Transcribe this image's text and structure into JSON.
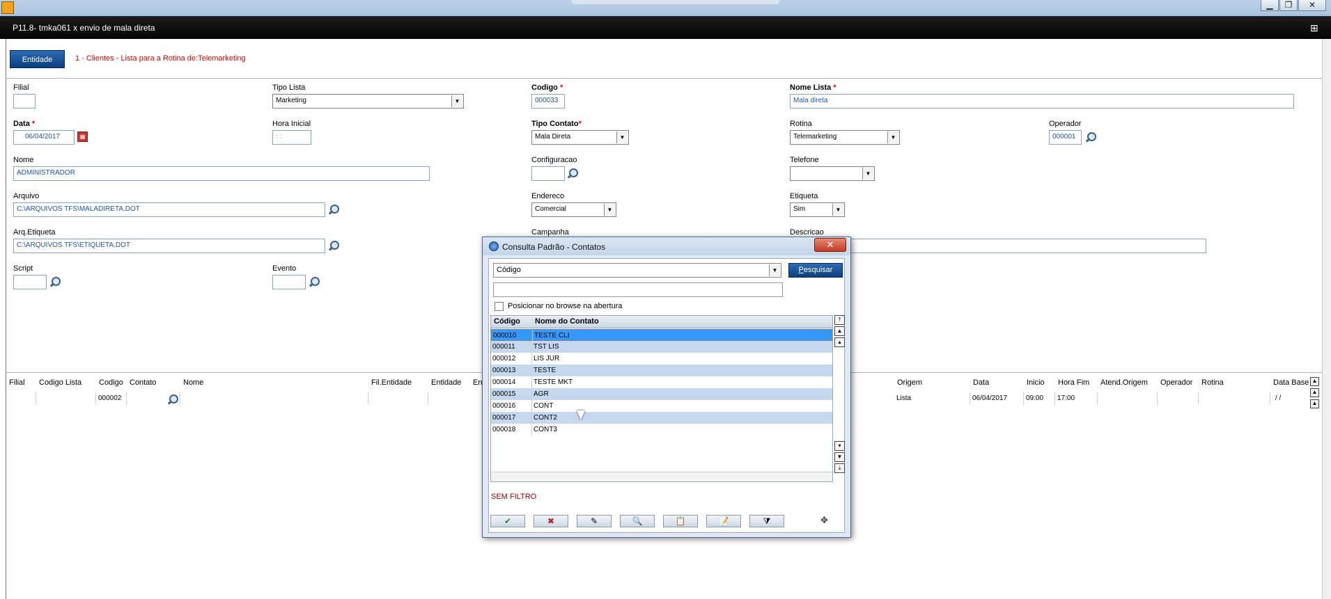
{
  "window": {
    "title": "P11.8- tmka061 x envio de mala direta",
    "minimize": "▁",
    "maximize": "❐",
    "close": "✕",
    "grid_icon": "⊞"
  },
  "entity": {
    "button": "Entidade",
    "description": "1 - Clientes - Lista para a Rotina de:Telemarketing"
  },
  "form": {
    "filial": {
      "label": "Filial",
      "value": ""
    },
    "tipo_lista": {
      "label": "Tipo Lista",
      "value": "Marketing"
    },
    "codigo": {
      "label": "Codigo",
      "value": "000033",
      "required": "*"
    },
    "nome_lista": {
      "label": "Nome Lista",
      "value": "Mala direta",
      "required": "*"
    },
    "data": {
      "label": "Data",
      "value": "06/04/2017",
      "required": "*"
    },
    "hora_inicial": {
      "label": "Hora Inicial",
      "value": " :  :"
    },
    "tipo_contato": {
      "label": "Tipo Contato",
      "value": "Mala Direta",
      "required": "*"
    },
    "rotina": {
      "label": "Rotina",
      "value": "Telemarketing"
    },
    "operador": {
      "label": "Operador",
      "value": "000001"
    },
    "nome": {
      "label": "Nome",
      "value": "ADMINISTRADOR"
    },
    "configuracao": {
      "label": "Configuracao",
      "value": ""
    },
    "telefone": {
      "label": "Telefone",
      "value": ""
    },
    "arquivo": {
      "label": "Arquivo",
      "value": "C:\\ARQUIVOS TFS\\MALADIRETA.DOT"
    },
    "endereco": {
      "label": "Endereco",
      "value": "Comercial"
    },
    "etiqueta": {
      "label": "Etiqueta",
      "value": "Sim"
    },
    "arq_etiqueta": {
      "label": "Arq.Etiqueta",
      "value": "C:\\ARQUIVOS TFS\\ETIQUETA.DOT"
    },
    "campanha": {
      "label": "Campanha",
      "value": ""
    },
    "descricao": {
      "label": "Descricao",
      "value": ""
    },
    "script": {
      "label": "Script",
      "value": ""
    },
    "evento": {
      "label": "Evento",
      "value": ""
    }
  },
  "grid": {
    "headers": [
      "Filial",
      "Codigo Lista",
      "Codigo",
      "Contato",
      "Nome",
      "Fil.Entidade",
      "Entidade",
      "Ent",
      "Origem",
      "Data",
      "Inicio",
      "Hora Fim",
      "Atend.Origem",
      "Operador",
      "Rotina",
      "Data Base"
    ],
    "row": {
      "codigo": "000002",
      "origem": "Lista",
      "data": "06/04/2017",
      "inicio": "09:00",
      "hora_fim": "17:00",
      "data_base": " / /"
    }
  },
  "dialog": {
    "title": "Consulta Padrão - Contatos",
    "close": "✕",
    "search_field": "Código",
    "search_button_accel": "P",
    "search_button_rest": "esquisar",
    "search_value": "",
    "checkbox_label": "Posicionar no browse na abertura",
    "columns": [
      "Código",
      "Nome do Contato"
    ],
    "rows": [
      {
        "codigo": "000010",
        "nome": "TESTE CLI"
      },
      {
        "codigo": "000011",
        "nome": "TST LIS"
      },
      {
        "codigo": "000012",
        "nome": "LIS JUR"
      },
      {
        "codigo": "000013",
        "nome": "TESTE"
      },
      {
        "codigo": "000014",
        "nome": "TESTE MKT"
      },
      {
        "codigo": "000015",
        "nome": "AGR"
      },
      {
        "codigo": "000016",
        "nome": "CONT"
      },
      {
        "codigo": "000017",
        "nome": "CONT2"
      },
      {
        "codigo": "000018",
        "nome": "CONT3"
      }
    ],
    "filter_text": "SEM FILTRO",
    "tools": [
      "✔",
      "✖",
      "✎",
      "🔍",
      "📋",
      "📝",
      "⧩"
    ],
    "move_icon": "✥"
  }
}
